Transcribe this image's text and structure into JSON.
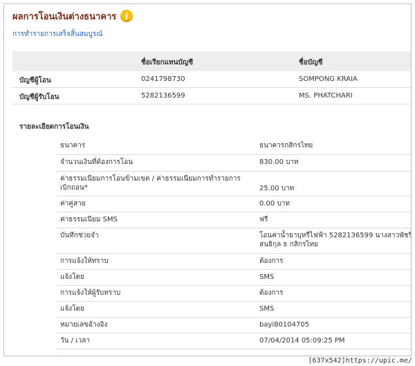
{
  "header": {
    "title": "ผลการโอนเงินต่างธนาคาร",
    "info_icon": "info-icon"
  },
  "status_link": "การทำรายการเสร็จสิ้นสมบูรณ์",
  "accounts": {
    "col_headers": [
      "",
      "ชื่อเรียกแทนบัญชี",
      "ชื่อบัญชี"
    ],
    "rows": [
      {
        "label": "บัญชีผู้โอน",
        "number": "0241798730",
        "name": "SOMPONG KRAIA"
      },
      {
        "label": "บัญชีผู้รับโอน",
        "number": "5282136599",
        "name": "MS. PHATCHARI"
      }
    ]
  },
  "details": {
    "section_title": "รายละเอียดการโอนเงิน",
    "rows": [
      {
        "label": "ธนาคาร",
        "value": "ธนาคารกสิกรไทย"
      },
      {
        "label": "จำนวนเงินที่ต้องการโอน",
        "value": "830.00 บาท"
      },
      {
        "label": "ค่าธรรมเนียมการโอนข้ามเขต / ค่าธรรมเนียมการทำรายการเบิกถอน*",
        "value": "25.00 บาท"
      },
      {
        "label": "ค่าคู่สาย",
        "value": "0.00 บาท"
      },
      {
        "label": "ค่าธรรมเนียม SMS",
        "value": "ฟรี"
      },
      {
        "label": "บันทึกช่วยจำ",
        "value": "โอนค่าน้ำยาบุหรี่ไฟฟ้า 5282136599 นางสาวพัชรี สนธิกุล ธ กสิกรไทย"
      },
      {
        "label": "การแจ้งให้ทราบ",
        "value": "ต้องการ"
      },
      {
        "label": "แจ้งโดย",
        "value": "SMS"
      },
      {
        "label": "การแจ้งให้ผู้รับทราบ",
        "value": "ต้องการ"
      },
      {
        "label": "แจ้งโดย",
        "value": "SMS"
      },
      {
        "label": "หมายเลขอ้างอิง",
        "value": "bayi80104705"
      },
      {
        "label": "วัน / เวลา",
        "value": "07/04/2014 05:09:25 PM"
      }
    ]
  },
  "watermark": "[637x542]https://upic.me/"
}
